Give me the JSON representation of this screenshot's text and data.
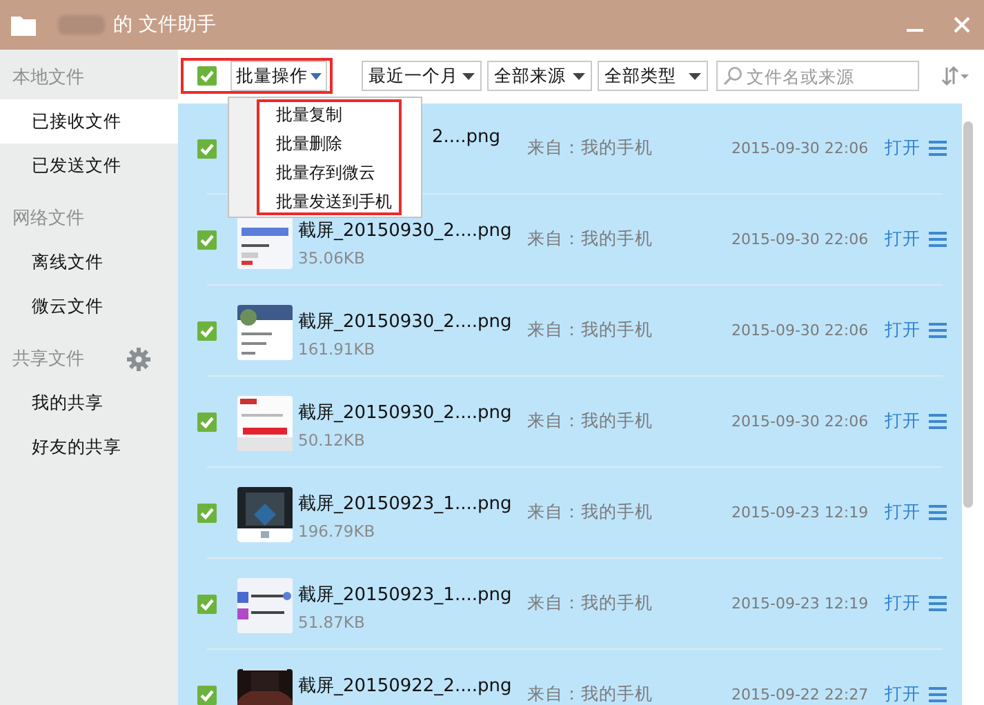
{
  "window": {
    "title": "的 文件助手"
  },
  "sidebar": {
    "sections": [
      {
        "label": "本地文件",
        "settings": false,
        "items": [
          {
            "label": "已接收文件",
            "selected": true
          },
          {
            "label": "已发送文件",
            "selected": false
          }
        ]
      },
      {
        "label": "网络文件",
        "settings": false,
        "items": [
          {
            "label": "离线文件",
            "selected": false
          },
          {
            "label": "微云文件",
            "selected": false
          }
        ]
      },
      {
        "label": "共享文件",
        "settings": true,
        "items": [
          {
            "label": "我的共享",
            "selected": false
          },
          {
            "label": "好友的共享",
            "selected": false
          }
        ]
      }
    ]
  },
  "toolbar": {
    "select_all": {
      "checked": true
    },
    "batch_button": "批量操作",
    "filters": [
      "最近一个月",
      "全部来源",
      "全部类型"
    ],
    "search": {
      "placeholder": "文件名或来源"
    }
  },
  "batch_menu": [
    "批量复制",
    "批量删除",
    "批量存到微云",
    "批量发送到手机"
  ],
  "files": [
    {
      "kind": "covered",
      "name": "2....png",
      "source": "来自：我的手机",
      "date": "2015-09-30 22:06",
      "action": "打开",
      "checked": true
    },
    {
      "kind": "full",
      "name": "截屏_20150930_2....png",
      "size": "35.06KB",
      "source": "来自：我的手机",
      "date": "2015-09-30 22:06",
      "action": "打开",
      "checked": true
    },
    {
      "kind": "full",
      "name": "截屏_20150930_2....png",
      "size": "161.91KB",
      "source": "来自：我的手机",
      "date": "2015-09-30 22:06",
      "action": "打开",
      "checked": true
    },
    {
      "kind": "full",
      "name": "截屏_20150930_2....png",
      "size": "50.12KB",
      "source": "来自：我的手机",
      "date": "2015-09-30 22:06",
      "action": "打开",
      "checked": true
    },
    {
      "kind": "full",
      "name": "截屏_20150923_1....png",
      "size": "196.79KB",
      "source": "来自：我的手机",
      "date": "2015-09-23 12:19",
      "action": "打开",
      "checked": true
    },
    {
      "kind": "full",
      "name": "截屏_20150923_1....png",
      "size": "51.87KB",
      "source": "来自：我的手机",
      "date": "2015-09-23 12:19",
      "action": "打开",
      "checked": true
    },
    {
      "kind": "full",
      "name": "截屏_20150922_2....png",
      "source": "来自：我的手机",
      "date": "2015-09-22 22:27",
      "action": "打开",
      "checked": true
    }
  ]
}
